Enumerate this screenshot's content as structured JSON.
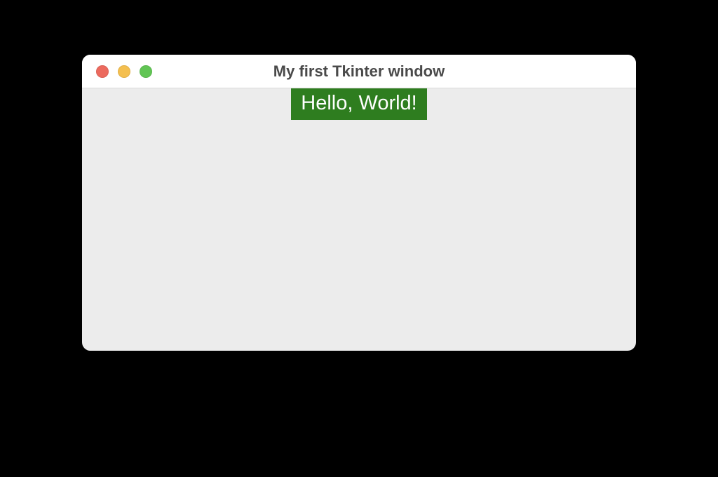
{
  "window": {
    "title": "My first Tkinter window"
  },
  "content": {
    "label_text": "Hello, World!"
  },
  "colors": {
    "label_bg": "#2e7d1f",
    "label_fg": "#ffffff",
    "window_bg": "#ececec",
    "titlebar_bg": "#ffffff"
  }
}
